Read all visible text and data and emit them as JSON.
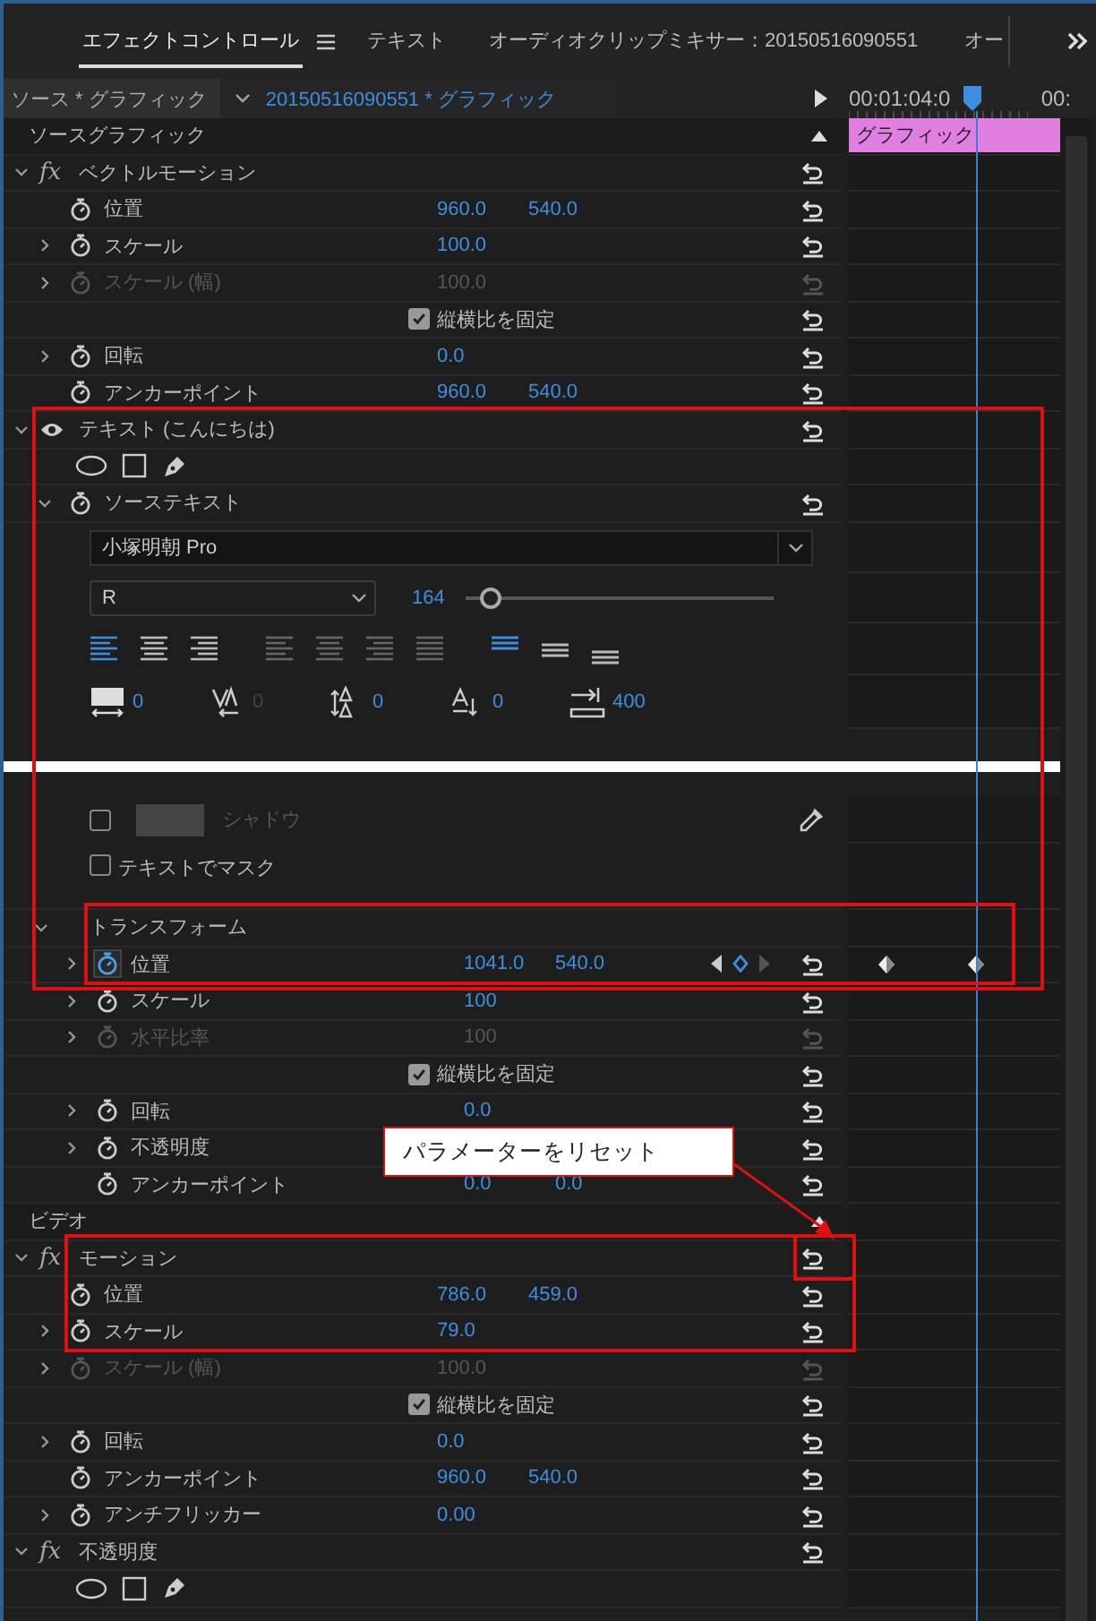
{
  "tabs": [
    {
      "label": "エフェクトコントロール",
      "selected": true
    },
    {
      "label": "テキスト",
      "selected": false
    },
    {
      "label": "オーディオクリップミキサー：20150516090551",
      "selected": false
    },
    {
      "label": "オー",
      "selected": false
    }
  ],
  "source": {
    "master": "ソース * グラフィック",
    "clip": "20150516090551  * グラフィック"
  },
  "timeline": {
    "timecode": "00:01:04:0",
    "next_timecode": "00:",
    "clip_label": "グラフィック"
  },
  "sections": [
    {
      "label": "ソースグラフィック",
      "effects": [
        {
          "label": "ベクトルモーション",
          "badge": "fx",
          "expanded": true,
          "children": [
            {
              "kind": "param",
              "label": "位置",
              "values": [
                "960.0",
                "540.0"
              ],
              "disabled": false
            },
            {
              "kind": "param",
              "label": "スケール",
              "values": [
                "100.0"
              ],
              "expanded": false,
              "disabled": false
            },
            {
              "kind": "param",
              "label": "スケール (幅)",
              "values": [
                "100.0"
              ],
              "expanded": false,
              "disabled": true
            },
            {
              "kind": "checkbox",
              "label": "縦横比を固定",
              "checked": true
            },
            {
              "kind": "param",
              "label": "回転",
              "values": [
                "0.0"
              ],
              "expanded": false,
              "disabled": false
            },
            {
              "kind": "param",
              "label": "アンカーポイント",
              "values": [
                "960.0",
                "540.0"
              ],
              "disabled": false
            }
          ]
        },
        {
          "label": "テキスト (こんにちは)",
          "visible": true,
          "expanded": true,
          "children": [
            {
              "kind": "tools"
            },
            {
              "kind": "param",
              "label": "ソーステキスト",
              "expanded": true,
              "disabled": false
            },
            {
              "kind": "font",
              "value": "小塚明朝 Pro"
            },
            {
              "kind": "style",
              "value": "R",
              "size": "164",
              "level": 0.08
            },
            {
              "kind": "align",
              "buttons": [
                {
                  "selected": true
                },
                {
                  "selected": false
                },
                {
                  "selected": false
                },
                {
                  "selected": false
                },
                {
                  "selected": false
                },
                {
                  "selected": false
                },
                {
                  "selected": false
                },
                {
                  "selected": true
                },
                {
                  "selected": false
                },
                {
                  "selected": false
                }
              ]
            },
            {
              "kind": "metrics",
              "items": [
                {
                  "value": "0",
                  "disabled": false
                },
                {
                  "value": "0",
                  "disabled": true
                },
                {
                  "value": "0",
                  "disabled": false
                },
                {
                  "value": "0",
                  "disabled": false
                },
                {
                  "value": "400",
                  "disabled": false
                }
              ]
            },
            {
              "kind": "splice"
            },
            {
              "kind": "swatch",
              "label": "シャドウ",
              "checked": false
            },
            {
              "kind": "mask",
              "label": "テキストでマスク",
              "checked": false
            },
            {
              "kind": "group",
              "label": "トランスフォーム",
              "expanded": true,
              "children": [
                {
                  "kind": "param",
                  "label": "位置",
                  "values": [
                    "1041.0",
                    "540.0"
                  ],
                  "expanded": false,
                  "disabled": false,
                  "animated": true
                },
                {
                  "kind": "param",
                  "label": "スケール",
                  "values": [
                    "100"
                  ],
                  "expanded": false,
                  "disabled": false
                },
                {
                  "kind": "param",
                  "label": "水平比率",
                  "values": [
                    "100"
                  ],
                  "expanded": false,
                  "disabled": true
                },
                {
                  "kind": "checkbox",
                  "label": "縦横比を固定",
                  "checked": true
                },
                {
                  "kind": "param",
                  "label": "回転",
                  "values": [
                    "0.0"
                  ],
                  "expanded": false,
                  "disabled": false
                },
                {
                  "kind": "param",
                  "label": "不透明度",
                  "expanded": false,
                  "disabled": false
                },
                {
                  "kind": "param",
                  "label": "アンカーポイント",
                  "values": [
                    "0.0",
                    "0.0"
                  ],
                  "disabled": false
                }
              ]
            }
          ]
        }
      ]
    },
    {
      "label": "ビデオ",
      "effects": [
        {
          "label": "モーション",
          "badge": "fx",
          "expanded": true,
          "children": [
            {
              "kind": "param",
              "label": "位置",
              "values": [
                "786.0",
                "459.0"
              ],
              "disabled": false
            },
            {
              "kind": "param",
              "label": "スケール",
              "values": [
                "79.0"
              ],
              "expanded": false,
              "disabled": false
            },
            {
              "kind": "param",
              "label": "スケール (幅)",
              "values": [
                "100.0"
              ],
              "expanded": false,
              "disabled": true
            },
            {
              "kind": "checkbox",
              "label": "縦横比を固定",
              "checked": true
            },
            {
              "kind": "param",
              "label": "回転",
              "values": [
                "0.0"
              ],
              "expanded": false,
              "disabled": false
            },
            {
              "kind": "param",
              "label": "アンカーポイント",
              "values": [
                "960.0",
                "540.0"
              ],
              "disabled": false
            },
            {
              "kind": "param",
              "label": "アンチフリッカー",
              "values": [
                "0.00"
              ],
              "expanded": false,
              "disabled": false
            }
          ]
        },
        {
          "label": "不透明度",
          "badge": "fx",
          "expanded": true,
          "children": [
            {
              "kind": "tools"
            }
          ]
        }
      ]
    }
  ],
  "annotation": {
    "callout": "パラメーターをリセット"
  }
}
